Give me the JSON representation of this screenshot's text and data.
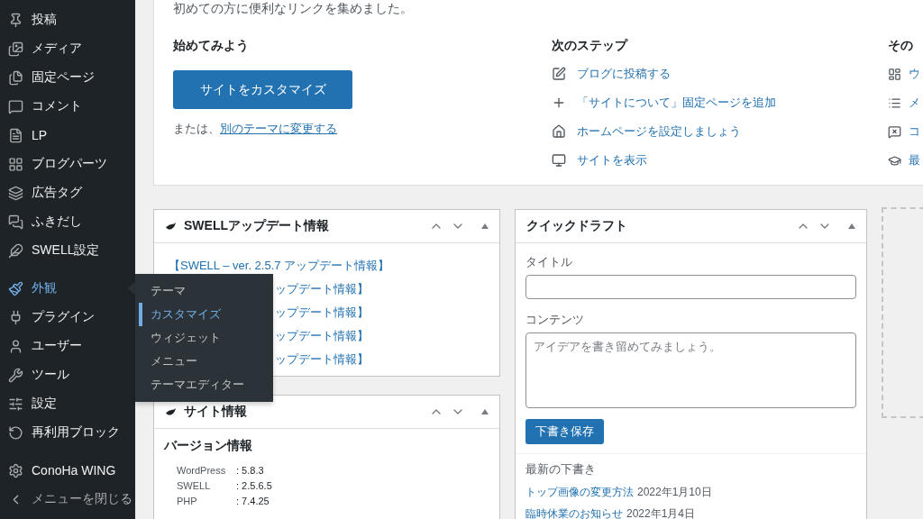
{
  "sidebar": {
    "groups": [
      [
        {
          "label": "投稿",
          "selected": false
        },
        {
          "label": "メディア",
          "selected": false
        },
        {
          "label": "固定ページ",
          "selected": false
        },
        {
          "label": "コメント",
          "selected": false
        },
        {
          "label": "LP",
          "selected": false
        },
        {
          "label": "ブログパーツ",
          "selected": false
        },
        {
          "label": "広告タグ",
          "selected": false
        },
        {
          "label": "ふきだし",
          "selected": false
        },
        {
          "label": "SWELL設定",
          "selected": false
        }
      ],
      [
        {
          "label": "外観",
          "selected": true
        },
        {
          "label": "プラグイン",
          "selected": false
        },
        {
          "label": "ユーザー",
          "selected": false
        },
        {
          "label": "ツール",
          "selected": false
        },
        {
          "label": "設定",
          "selected": false
        },
        {
          "label": "再利用ブロック",
          "selected": false
        }
      ],
      [
        {
          "label": "ConoHa WING",
          "selected": false
        },
        {
          "label": "メニューを閉じる",
          "selected": false
        }
      ]
    ],
    "flyout": [
      {
        "label": "テーマ",
        "selected": false
      },
      {
        "label": "カスタマイズ",
        "selected": true
      },
      {
        "label": "ウィジェット",
        "selected": false
      },
      {
        "label": "メニュー",
        "selected": false
      },
      {
        "label": "テーマエディター",
        "selected": false
      }
    ]
  },
  "welcome": {
    "intro": "初めての方に便利なリンクを集めました。",
    "get_started": {
      "heading": "始めてみよう",
      "button": "サイトをカスタマイズ",
      "or_text": "または、",
      "link": "別のテーマに変更する"
    },
    "next_steps": {
      "heading": "次のステップ",
      "links": [
        "ブログに投稿する",
        "「サイトについて」固定ページを追加",
        "ホームページを設定しましょう",
        "サイトを表示"
      ]
    },
    "more": {
      "heading": "その",
      "links": [
        "ウ",
        "メ",
        "コ",
        "最"
      ]
    }
  },
  "swell_updates": {
    "title": "SWELLアップデート情報",
    "items": [
      "【SWELL – ver. 2.5.7 アップデート情報】",
      "ップデート情報】",
      "ップデート情報】",
      "ップデート情報】",
      "ップデート情報】"
    ]
  },
  "site_info": {
    "title": "サイト情報",
    "heading": "バージョン情報",
    "rows": [
      {
        "name": "WordPress",
        "value": ": 5.8.3"
      },
      {
        "name": "SWELL",
        "value": ": 2.5.6.5"
      },
      {
        "name": "PHP",
        "value": ": 7.4.25"
      }
    ]
  },
  "quick_draft": {
    "title": "クイックドラフト",
    "title_label": "タイトル",
    "content_label": "コンテンツ",
    "content_placeholder": "アイデアを書き留めてみましょう。",
    "save_button": "下書き保存",
    "recent_heading": "最新の下書き",
    "drafts": [
      {
        "title": "トップ画像の変更方法",
        "date": "2022年1月10日"
      },
      {
        "title": "臨時休業のお知らせ",
        "date": "2022年1月4日"
      }
    ]
  }
}
